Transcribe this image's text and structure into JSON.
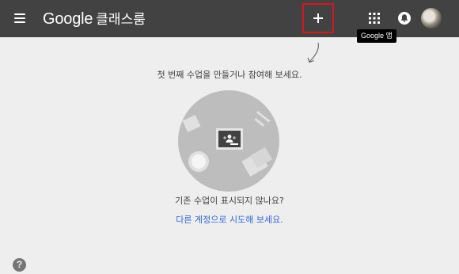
{
  "header": {
    "brand_google": "Google",
    "brand_product": "클래스룸",
    "menu_icon": "hamburger-menu-icon",
    "add_icon": "plus-icon",
    "apps_icon": "apps-grid-icon",
    "notifications_icon": "bell-icon",
    "apps_tooltip": "Google 앱"
  },
  "main": {
    "hint": "첫 번째 수업을 만들거나 참여해 보세요.",
    "illustration_icon": "classroom-illustration",
    "missing_text": "기존 수업이 표시되지 않나요?",
    "switch_link": "다른 계정으로 시도해 보세요."
  },
  "footer": {
    "help_label": "?"
  },
  "colors": {
    "topbar": "#424242",
    "background": "#eeeeee",
    "highlight_border": "#d0191e",
    "link": "#3367d6"
  }
}
